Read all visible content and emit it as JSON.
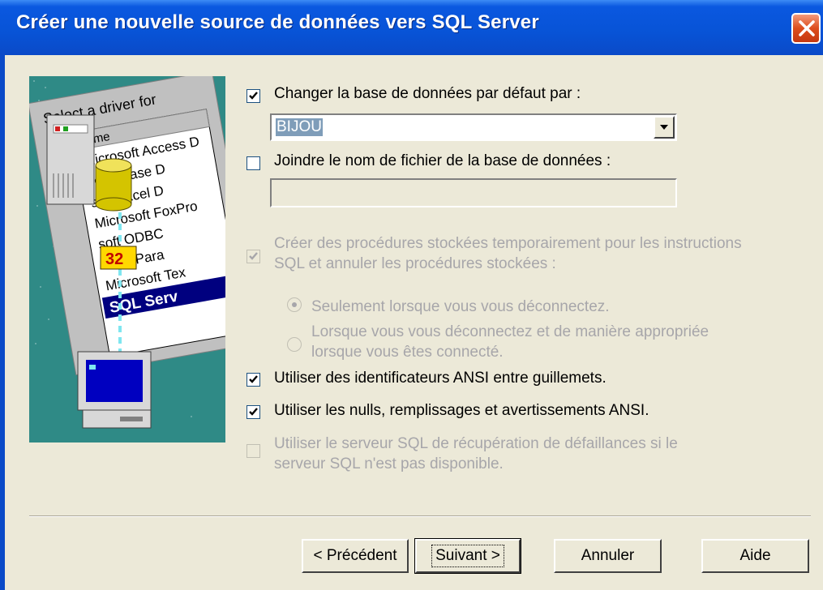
{
  "window": {
    "title": "Créer une nouvelle source de données vers SQL Server"
  },
  "options": {
    "change_db": {
      "label": "Changer la base de données par défaut par :",
      "checked": true
    },
    "database_value": "BIJOU",
    "attach_db": {
      "label": "Joindre le nom de fichier de la base de données :",
      "checked": false
    },
    "attach_value": "",
    "temp_procs": {
      "label_line1": "Créer des procédures stockées temporairement pour les instructions",
      "label_line2": "SQL et annuler les procédures stockées :",
      "checked": true,
      "enabled": false
    },
    "radio_disconnect": {
      "label": "Seulement lorsque vous vous déconnectez.",
      "selected": true
    },
    "radio_appropriate": {
      "label_line1": "Lorsque vous vous déconnectez et de manière appropriée",
      "label_line2": "lorsque vous êtes connecté.",
      "selected": false
    },
    "ansi_quoted": {
      "label": "Utiliser des identificateurs ANSI entre guillemets.",
      "checked": true
    },
    "ansi_nulls": {
      "label": "Utiliser les nulls, remplissages et avertissements ANSI.",
      "checked": true
    },
    "failover": {
      "label_line1": "Utiliser le serveur SQL de récupération de défaillances si le",
      "label_line2": "serveur SQL n'est pas disponible.",
      "checked": false,
      "enabled": false
    }
  },
  "illustration": {
    "header": "Select a driver for",
    "column": "Name",
    "items": [
      "Microsoft Access D",
      "soft dBase D",
      "soft Excel D",
      "Microsoft FoxPro",
      "soft ODBC",
      "osoft Para",
      "Microsoft Tex",
      "SQL Serv"
    ],
    "badge": "32"
  },
  "buttons": {
    "back": "< Précédent",
    "next": "Suivant >",
    "cancel": "Annuler",
    "help": "Aide"
  },
  "colors": {
    "title_blue": "#0853d6",
    "dialog_bg": "#ece9d8",
    "illus_teal": "#2f8a86",
    "selection": "#00007f"
  }
}
